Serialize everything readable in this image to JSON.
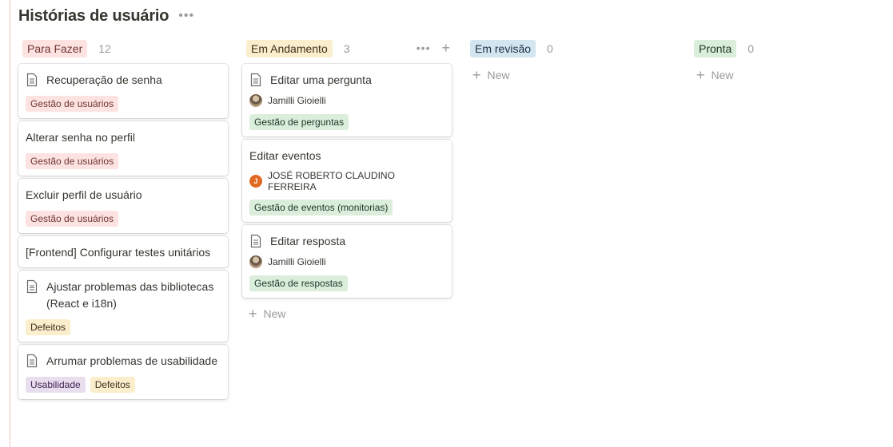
{
  "page": {
    "title": "Histórias de usuário"
  },
  "columns": [
    {
      "name": "Para Fazer",
      "count": "12",
      "bg": "#fde2e2",
      "fg": "#6e3630",
      "cards": [
        {
          "title": "Recuperação de senha",
          "icon": "document-icon",
          "tags": [
            {
              "label": "Gestão de usuários",
              "color": "red"
            }
          ]
        },
        {
          "title": "Alterar senha no perfil",
          "icon": null,
          "tags": [
            {
              "label": "Gestão de usuários",
              "color": "red"
            }
          ]
        },
        {
          "title": "Excluir perfil de usuário",
          "icon": null,
          "tags": [
            {
              "label": "Gestão de usuários",
              "color": "red"
            }
          ]
        },
        {
          "title": "[Frontend] Configurar testes unitários",
          "icon": null,
          "tags": []
        },
        {
          "title": "Ajustar problemas das bibliotecas (React e i18n)",
          "icon": "document-icon",
          "tags": [
            {
              "label": "Defeitos",
              "color": "yellow"
            }
          ]
        },
        {
          "title": "Arrumar problemas de usabilidade",
          "icon": "document-icon",
          "tags": [
            {
              "label": "Usabilidade",
              "color": "purple"
            },
            {
              "label": "Defeitos",
              "color": "yellow"
            }
          ]
        }
      ]
    },
    {
      "name": "Em Andamento",
      "count": "3",
      "bg": "#fbeecc",
      "fg": "#402c1b",
      "show_actions": true,
      "cards": [
        {
          "title": "Editar uma pergunta",
          "icon": "document-icon",
          "person": {
            "name": "Jamilli Gioielli",
            "avatar": "photo"
          },
          "tags": [
            {
              "label": "Gestão de perguntas",
              "color": "green"
            }
          ]
        },
        {
          "title": "Editar eventos",
          "icon": null,
          "person": {
            "name": "JOSÉ ROBERTO CLAUDINO FERREIRA",
            "avatar": "letter",
            "initial": "J"
          },
          "tags": [
            {
              "label": "Gestão de eventos (monitorias)",
              "color": "green"
            }
          ]
        },
        {
          "title": "Editar resposta",
          "icon": "document-icon",
          "person": {
            "name": "Jamilli Gioielli",
            "avatar": "photo"
          },
          "tags": [
            {
              "label": "Gestão de respostas",
              "color": "green"
            }
          ]
        }
      ],
      "new_label": "New"
    },
    {
      "name": "Em revisão",
      "count": "0",
      "bg": "#d3e5ef",
      "fg": "#183347",
      "cards": [],
      "new_label": "New"
    },
    {
      "name": "Pronta",
      "count": "0",
      "bg": "#dbeddb",
      "fg": "#1c3829",
      "cards": [],
      "new_label": "New"
    }
  ]
}
